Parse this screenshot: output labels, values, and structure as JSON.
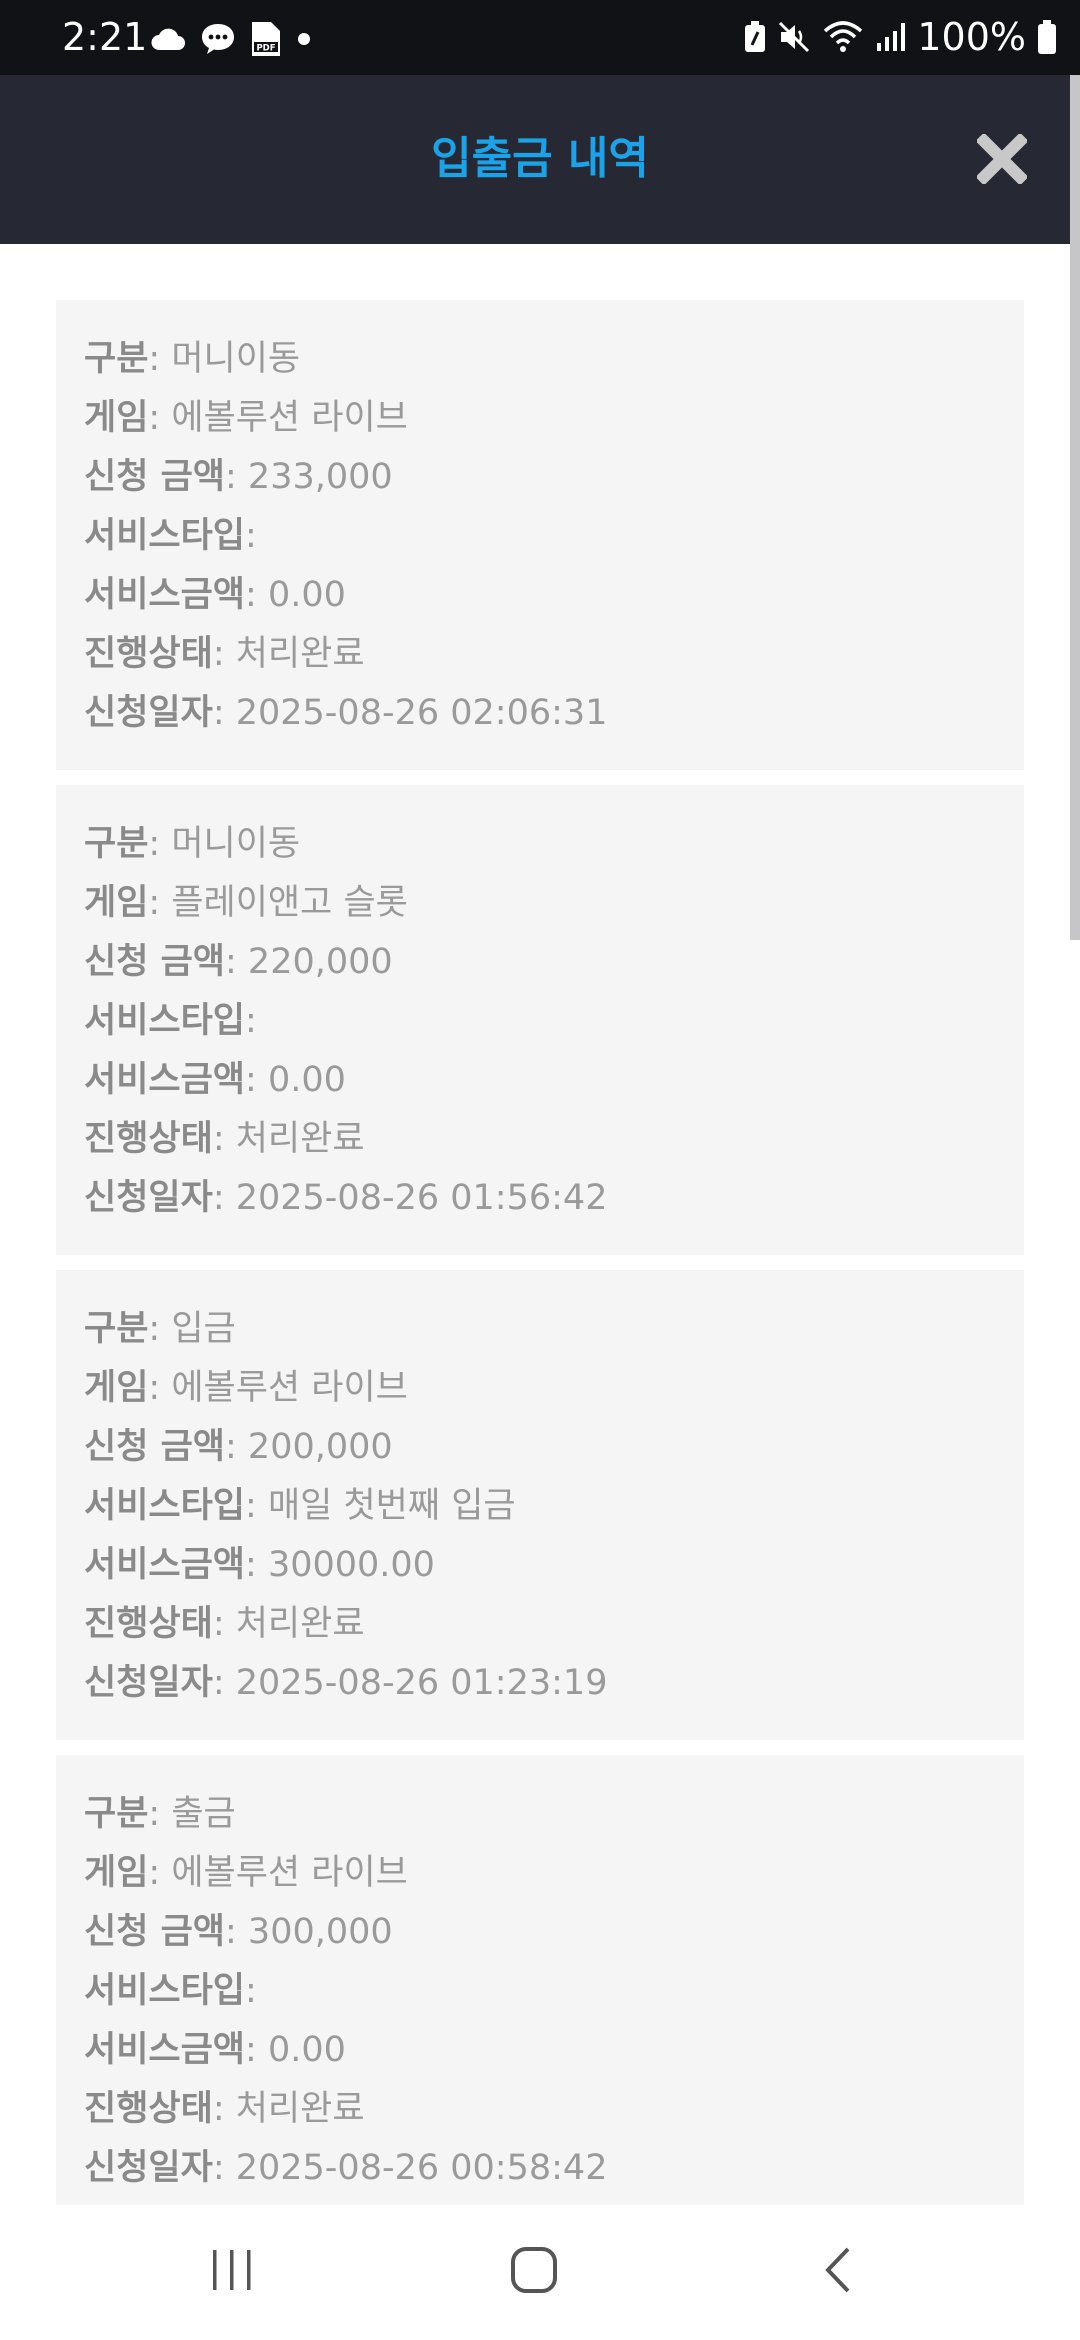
{
  "status_bar": {
    "time": "2:21",
    "battery": "100%"
  },
  "header": {
    "title": "입출금 내역"
  },
  "records": [
    {
      "type_label": "구분",
      "type": "머니이동",
      "game_label": "게임",
      "game": "에볼루션 라이브",
      "amount_label": "신청 금액",
      "amount": "233,000",
      "service_type_label": "서비스타입",
      "service_type": "",
      "service_amount_label": "서비스금액",
      "service_amount": "0.00",
      "status_label": "진행상태",
      "status": "처리완료",
      "date_label": "신청일자",
      "date": "2025-08-26 02:06:31"
    },
    {
      "type_label": "구분",
      "type": "머니이동",
      "game_label": "게임",
      "game": "플레이앤고 슬롯",
      "amount_label": "신청 금액",
      "amount": "220,000",
      "service_type_label": "서비스타입",
      "service_type": "",
      "service_amount_label": "서비스금액",
      "service_amount": "0.00",
      "status_label": "진행상태",
      "status": "처리완료",
      "date_label": "신청일자",
      "date": "2025-08-26 01:56:42"
    },
    {
      "type_label": "구분",
      "type": "입금",
      "game_label": "게임",
      "game": "에볼루션 라이브",
      "amount_label": "신청 금액",
      "amount": "200,000",
      "service_type_label": "서비스타입",
      "service_type": "매일 첫번째 입금",
      "service_amount_label": "서비스금액",
      "service_amount": "30000.00",
      "status_label": "진행상태",
      "status": "처리완료",
      "date_label": "신청일자",
      "date": "2025-08-26 01:23:19"
    },
    {
      "type_label": "구분",
      "type": "출금",
      "game_label": "게임",
      "game": "에볼루션 라이브",
      "amount_label": "신청 금액",
      "amount": "300,000",
      "service_type_label": "서비스타입",
      "service_type": "",
      "service_amount_label": "서비스금액",
      "service_amount": "0.00",
      "status_label": "진행상태",
      "status": "처리완료",
      "date_label": "신청일자",
      "date": "2025-08-26 00:58:42"
    }
  ]
}
